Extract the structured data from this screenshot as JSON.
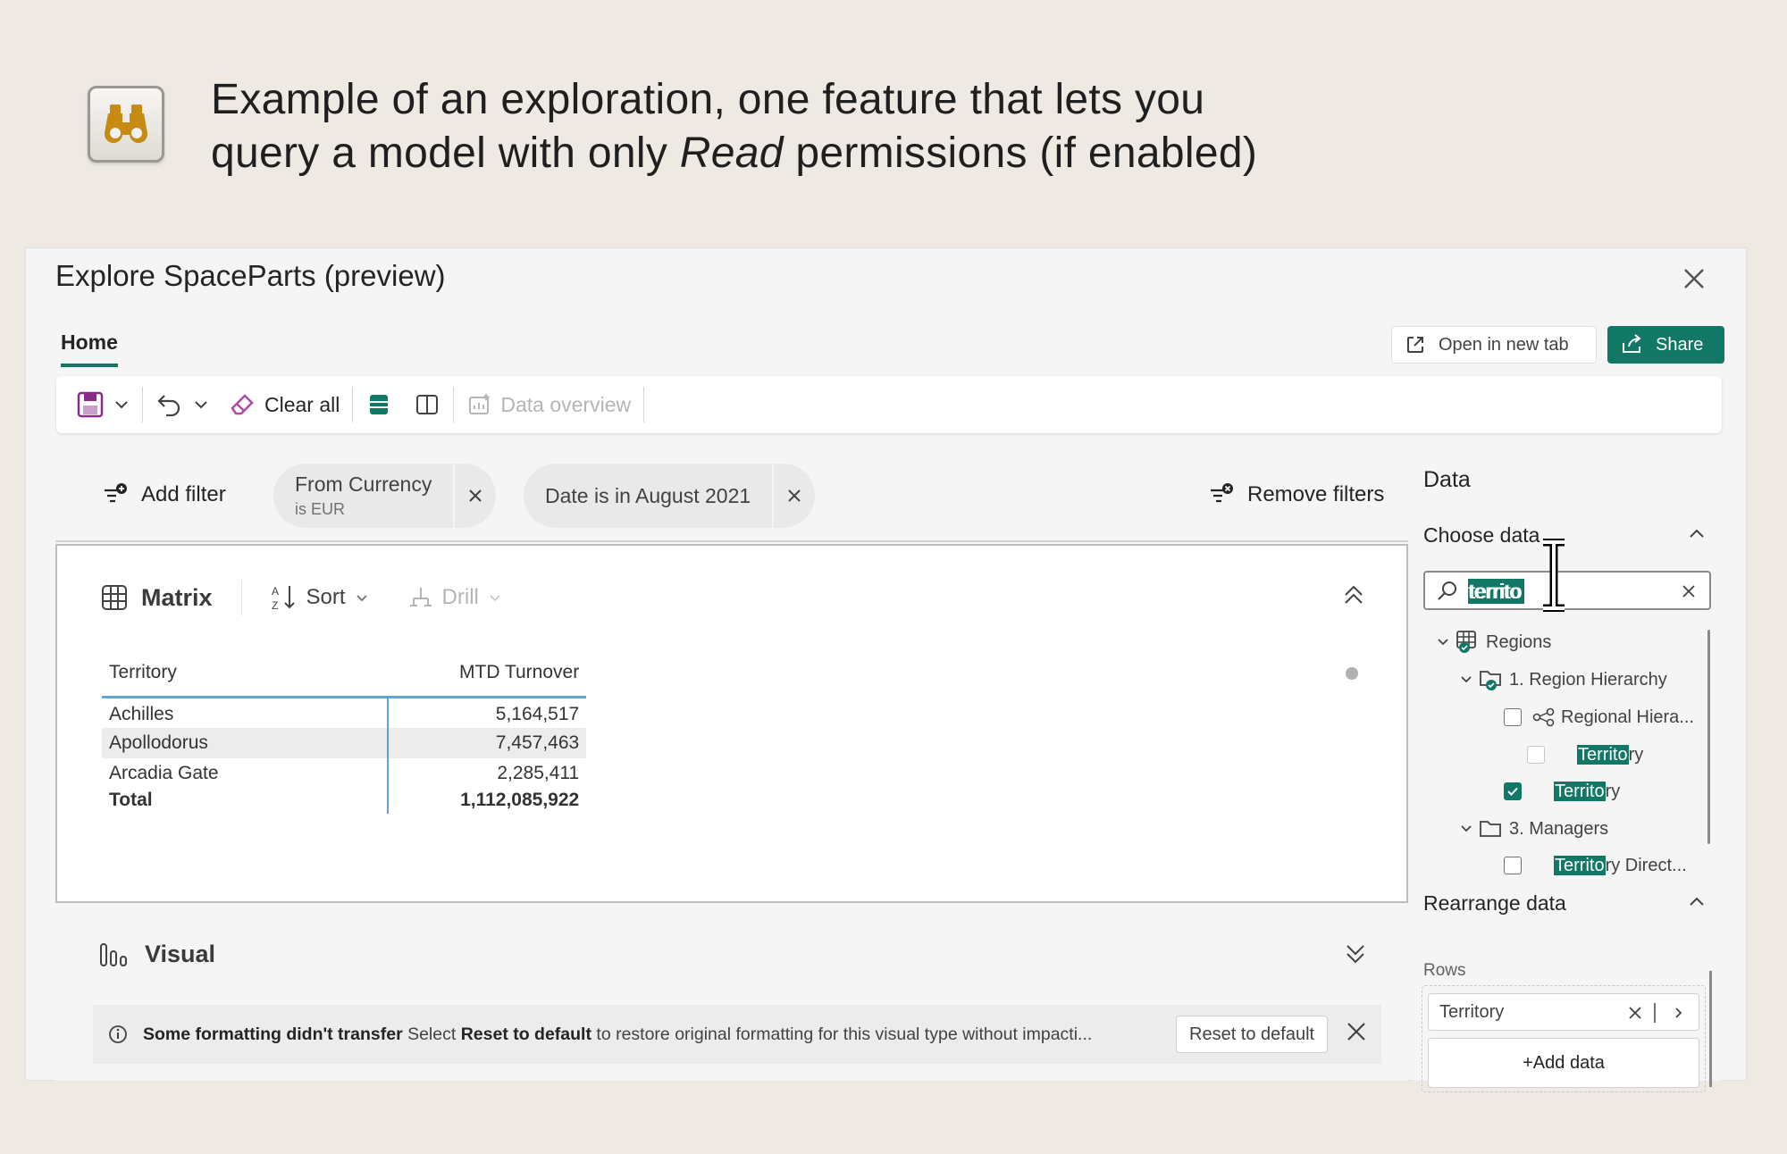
{
  "hero": {
    "line1": "Example of an exploration, one feature that lets you",
    "line2_pre": "query a model with only ",
    "line2_em": "Read",
    "line2_post": " permissions (if enabled)"
  },
  "window": {
    "title": "Explore SpaceParts (preview)",
    "tab_home": "Home",
    "open_new_tab": "Open in new tab",
    "share": "Share"
  },
  "toolbar": {
    "clear_all": "Clear all",
    "data_overview": "Data overview"
  },
  "filters": {
    "add_filter": "Add filter",
    "chip1_title": "From Currency",
    "chip1_sub": "is EUR",
    "chip2_title": "Date is in August 2021",
    "remove_filters": "Remove filters"
  },
  "matrix": {
    "title": "Matrix",
    "sort": "Sort",
    "drill": "Drill",
    "columns": [
      "Territory",
      "MTD Turnover"
    ],
    "rows": [
      [
        "Achilles",
        "5,164,517"
      ],
      [
        "Apollodorus",
        "7,457,463"
      ],
      [
        "Arcadia Gate",
        "2,285,411"
      ]
    ],
    "total_label": "Total",
    "total_value": "1,112,085,922"
  },
  "visual": {
    "title": "Visual",
    "info_bold": "Some formatting didn't transfer",
    "info_mid": " Select ",
    "info_bold2": "Reset to default",
    "info_tail": " to restore original formatting for this visual type without impacti...",
    "reset_button": "Reset to default"
  },
  "data_pane": {
    "title": "Data",
    "choose_data": "Choose data",
    "search_value": "territo",
    "tree": {
      "regions": "Regions",
      "region_hierarchy": "1. Region Hierarchy",
      "regional_hiera": "Regional Hiera...",
      "territory_a_hl": "Territo",
      "territory_a_rest": "ry",
      "territory_b_hl": "Territo",
      "territory_b_rest": "ry",
      "managers": "3. Managers",
      "territory_dir_hl": "Territo",
      "territory_dir_rest": "ry Direct..."
    },
    "rearrange_data": "Rearrange data",
    "rows_label": "Rows",
    "rows_field": "Territory",
    "add_data": "+Add data"
  },
  "colors": {
    "accent": "#117865",
    "background": "#eeeae3"
  }
}
